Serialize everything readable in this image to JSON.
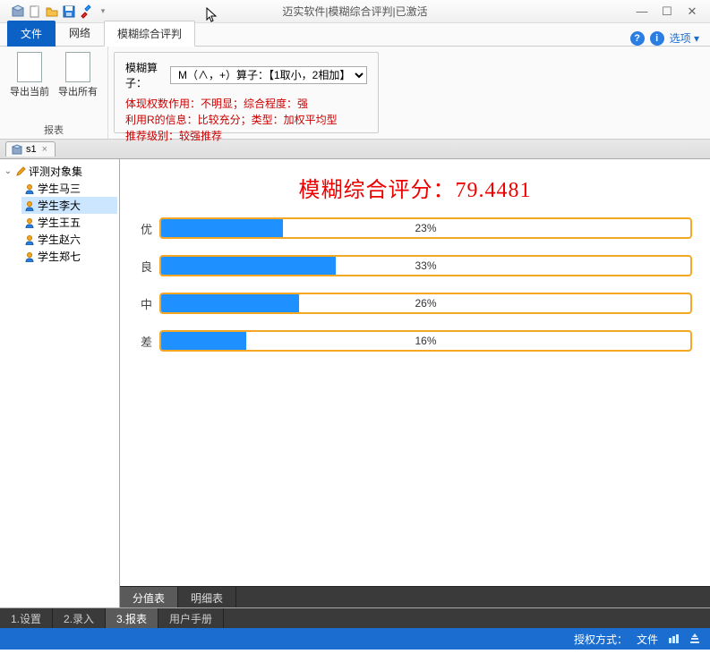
{
  "window": {
    "title": "迈实软件|模糊综合评判|已激活"
  },
  "tabs": {
    "file": "文件",
    "network": "网络",
    "fuzzy": "模糊综合评判"
  },
  "options_label": "选项",
  "ribbon": {
    "export_current": "导出当前",
    "export_all": "导出所有",
    "group_title": "报表",
    "operator_label": "模糊算子：",
    "operator_value": "M（∧，+）算子：【1取小，2相加】",
    "hint1": "体现权数作用：不明显；综合程度：强",
    "hint2": "利用R的信息：比较充分；类型：加权平均型",
    "hint3": "推荐级别：较强推荐"
  },
  "doc_tab": {
    "name": "s1"
  },
  "tree": {
    "root": "评测对象集",
    "items": [
      {
        "label": "学生马三"
      },
      {
        "label": "学生李大"
      },
      {
        "label": "学生王五"
      },
      {
        "label": "学生赵六"
      },
      {
        "label": "学生郑七"
      }
    ],
    "selected_index": 1
  },
  "chart_data": {
    "type": "bar",
    "title": "模糊综合评分：79.4481",
    "categories": [
      "优",
      "良",
      "中",
      "差"
    ],
    "values": [
      23,
      33,
      26,
      16
    ],
    "value_labels": [
      "23%",
      "33%",
      "26%",
      "16%"
    ],
    "xlim": [
      0,
      100
    ]
  },
  "sub_tabs": {
    "items": [
      "分值表",
      "明细表"
    ],
    "active_index": 0
  },
  "bottom_tabs": {
    "items": [
      "1.设置",
      "2.录入",
      "3.报表",
      "用户手册"
    ],
    "active_index": 2
  },
  "status": {
    "label": "授权方式：",
    "value": "文件"
  }
}
